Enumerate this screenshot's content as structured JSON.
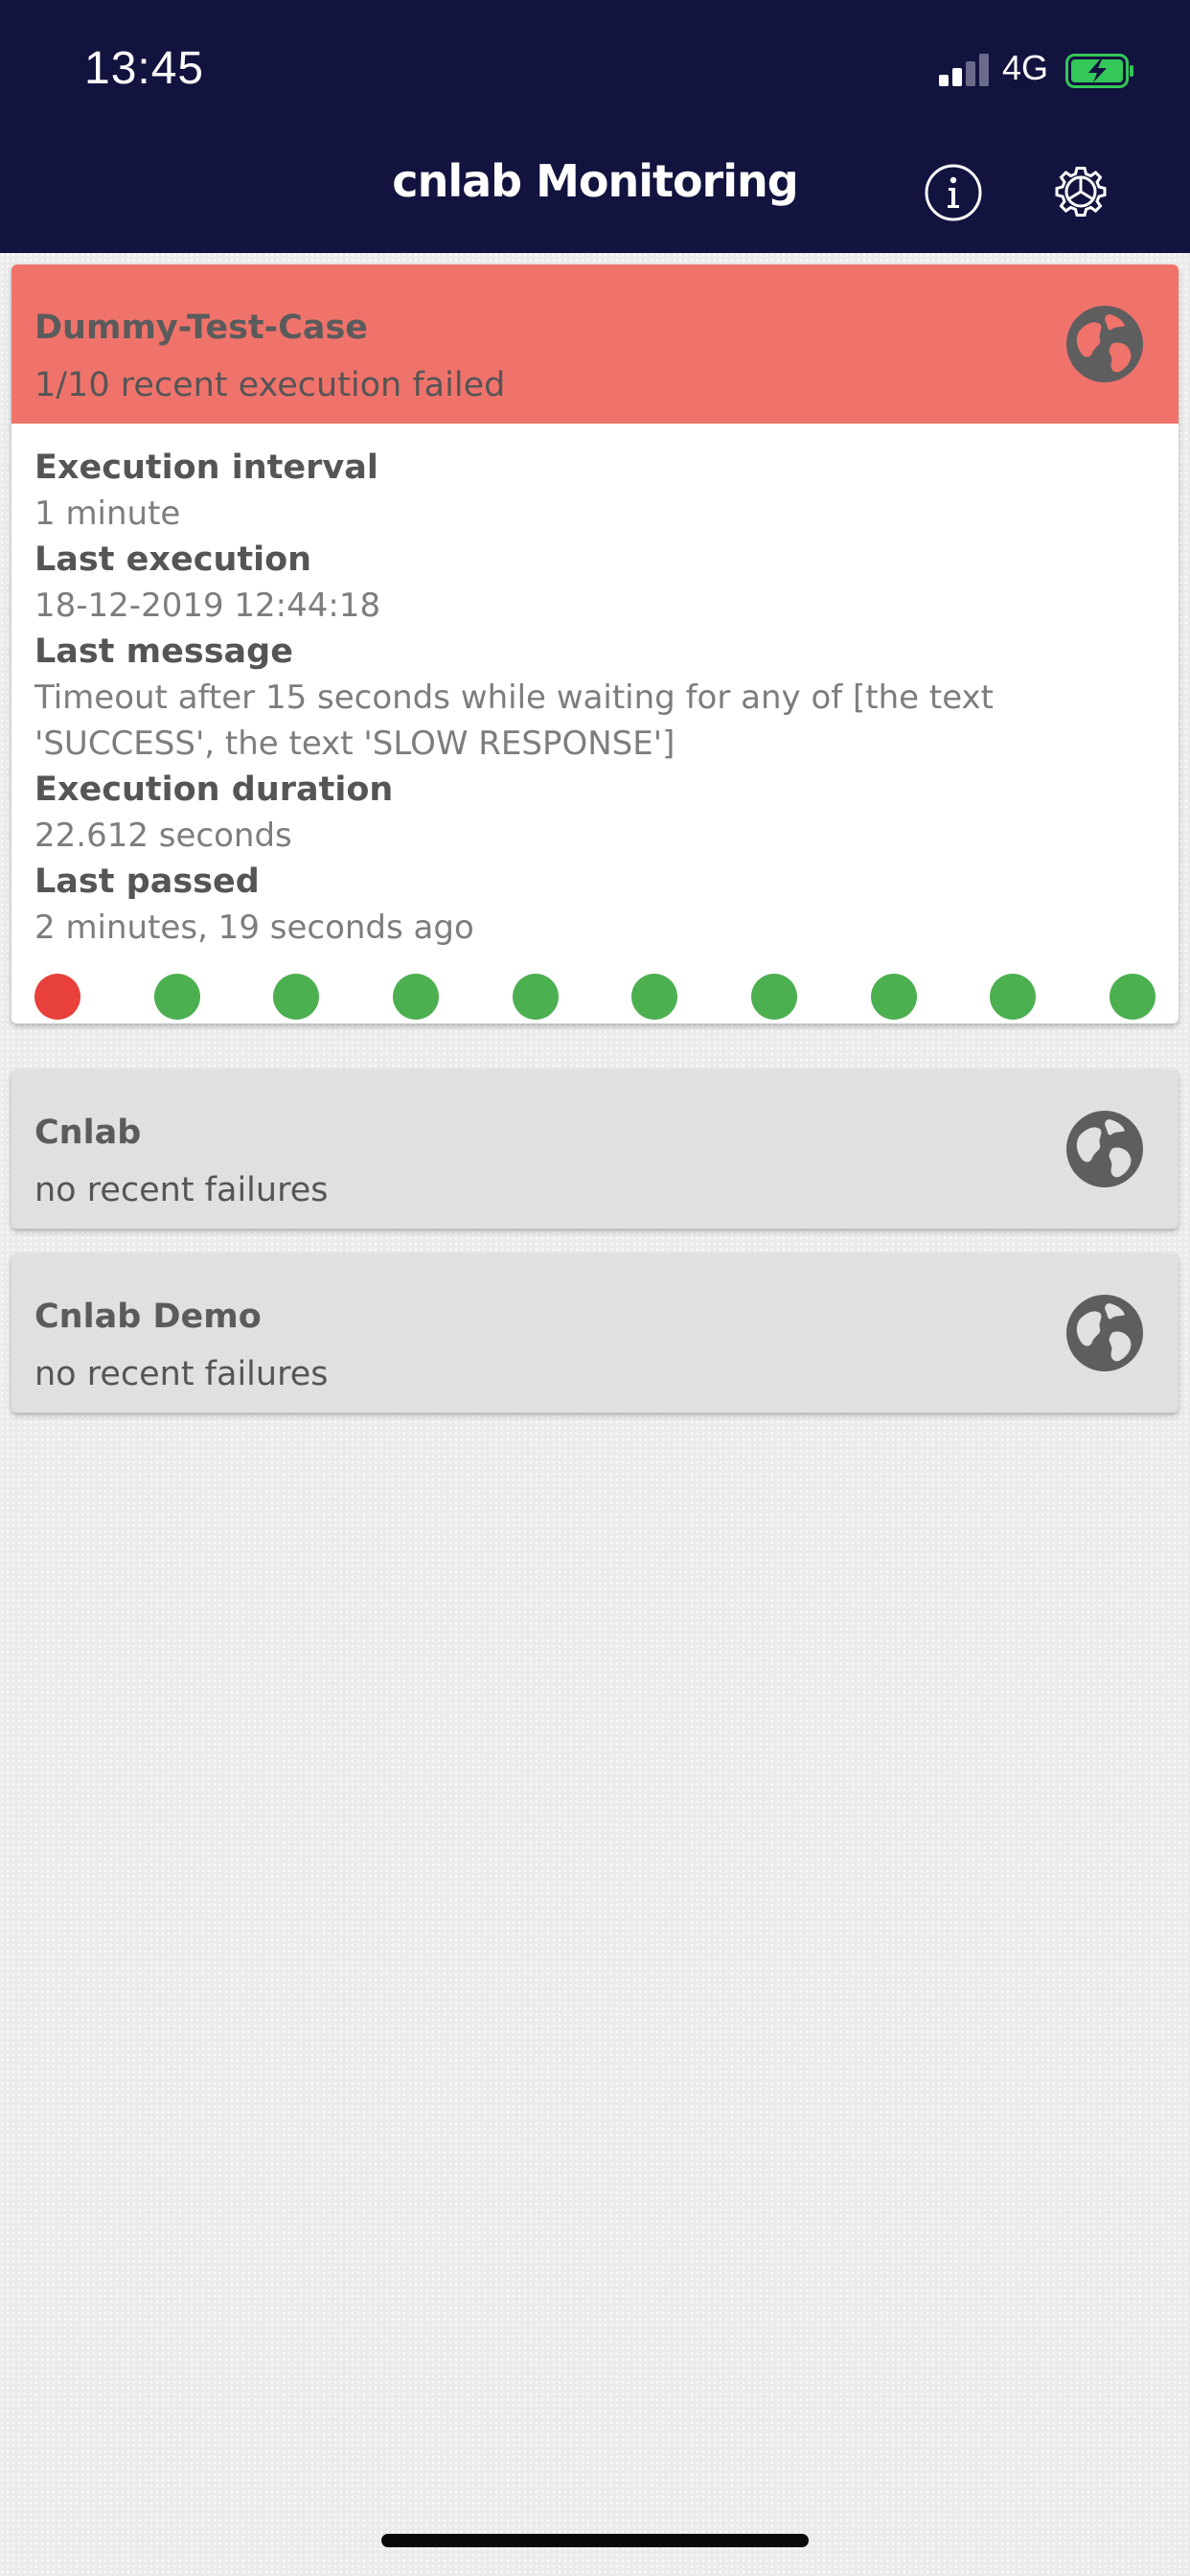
{
  "status_bar": {
    "time": "13:45",
    "network": "4G"
  },
  "header": {
    "title": "cnlab Monitoring"
  },
  "colors": {
    "header_bg": "#13133f",
    "failed_bg": "#f0736b",
    "ok_card_bg": "#e0e0e0",
    "fail_dot": "#e8403a",
    "pass_dot": "#4caf50",
    "battery_green": "#34c759"
  },
  "cards": [
    {
      "title": "Dummy-Test-Case",
      "subtitle": "1/10 recent execution failed",
      "state": "failed",
      "icon": "globe-icon",
      "expanded": true,
      "fields": [
        {
          "label": "Execution interval",
          "value": "1 minute"
        },
        {
          "label": "Last execution",
          "value": "18-12-2019 12:44:18"
        },
        {
          "label": "Last message",
          "value": "Timeout after 15 seconds while waiting for any of [the text 'SUCCESS', the text 'SLOW RESPONSE']"
        },
        {
          "label": "Execution duration",
          "value": "22.612 seconds"
        },
        {
          "label": "Last passed",
          "value": "2 minutes, 19 seconds ago"
        }
      ],
      "history": [
        "fail",
        "pass",
        "pass",
        "pass",
        "pass",
        "pass",
        "pass",
        "pass",
        "pass",
        "pass"
      ]
    },
    {
      "title": "Cnlab",
      "subtitle": "no recent failures",
      "state": "ok",
      "icon": "globe-icon",
      "expanded": false
    },
    {
      "title": "Cnlab Demo",
      "subtitle": "no recent failures",
      "state": "ok",
      "icon": "globe-icon",
      "expanded": false
    }
  ]
}
